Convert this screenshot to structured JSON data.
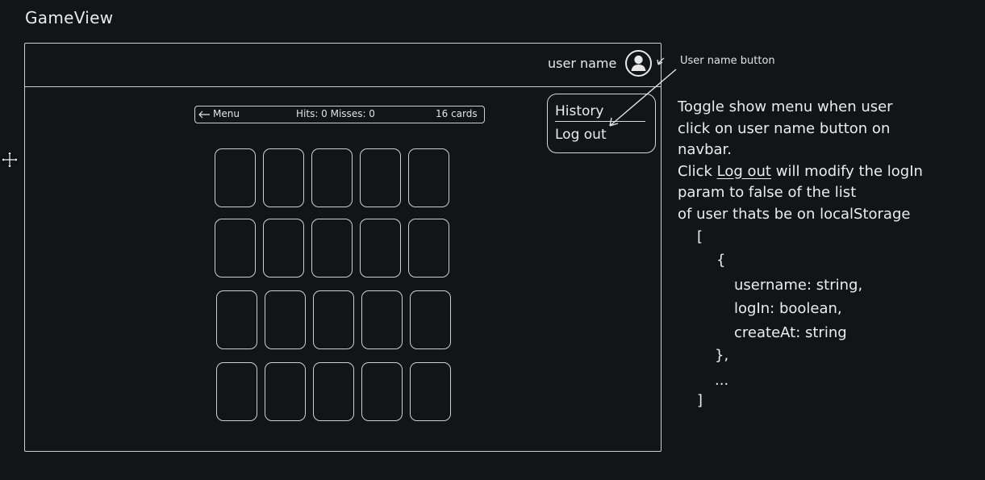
{
  "title": "GameView",
  "navbar": {
    "username_label": "user name",
    "avatar_icon": "user-avatar-icon"
  },
  "user_menu": {
    "items": [
      "History",
      "Log out"
    ]
  },
  "game_bar": {
    "menu_label": "Menu",
    "menu_icon": "arrow-left-icon",
    "score_text": "Hits: 0 Misses: 0",
    "cards_text": "16 cards"
  },
  "board": {
    "rows": 4,
    "columns": 5
  },
  "annotations": {
    "user_name_button": "User name button",
    "note_intro": "Toggle show menu when user\nclick on user name button on\nnavbar.",
    "note_click": "Click",
    "note_link": "Log out",
    "note_rest": "will modify the logIn",
    "note_tail": "param to false of the list\nof user thats be on localStorage",
    "code_lines": [
      "[",
      "{",
      "username: string,",
      "logIn: boolean,",
      "createAt: string",
      "},",
      "...",
      "]"
    ]
  },
  "colors": {
    "background": "#121418",
    "stroke": "#cfcfcf",
    "text": "#e8e8e8"
  }
}
